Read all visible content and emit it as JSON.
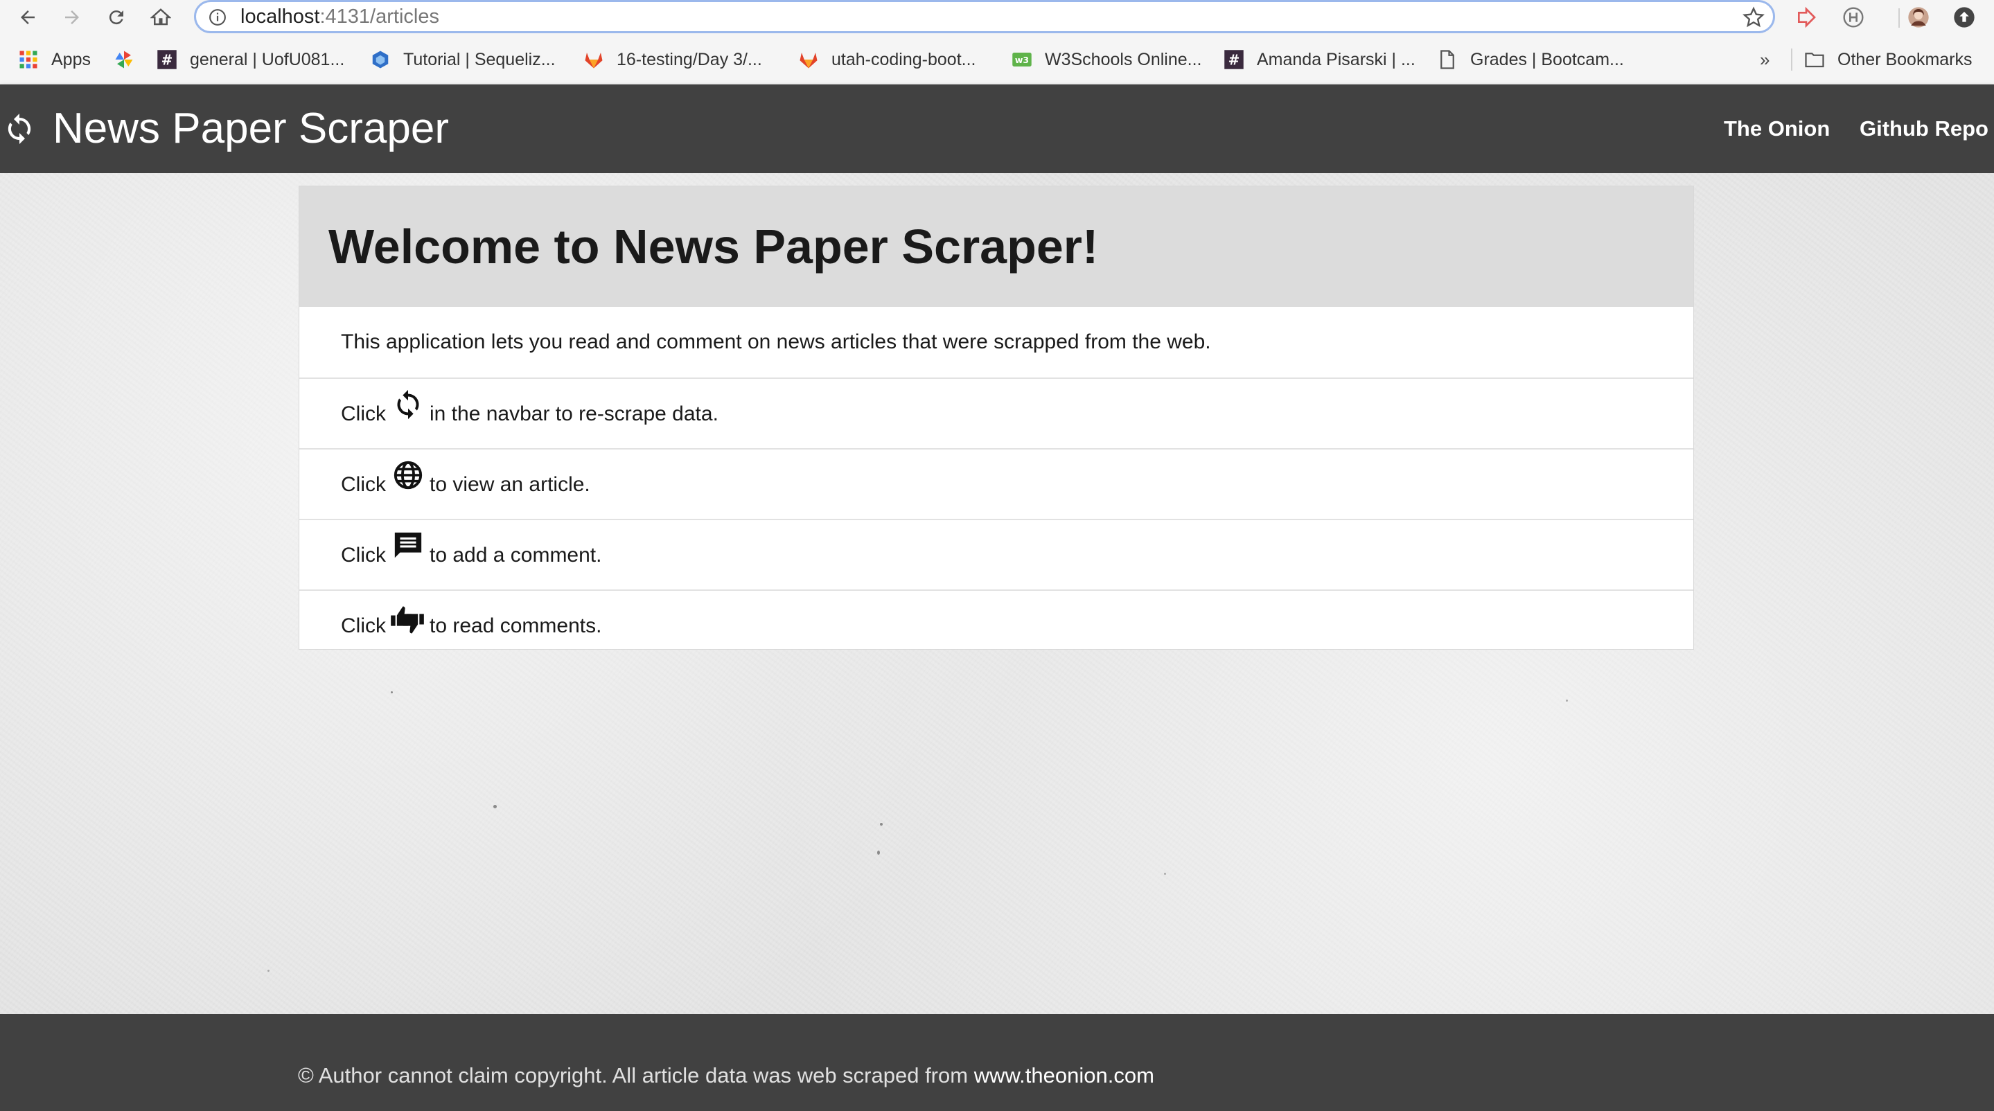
{
  "browser": {
    "url_host": "localhost",
    "url_path": ":4131/articles",
    "bookmarks": [
      {
        "label": "Apps",
        "icon": "apps-grid-icon"
      },
      {
        "label": "",
        "icon": "pinwheel-icon"
      },
      {
        "label": "general | UofU081...",
        "icon": "slack-hash-icon"
      },
      {
        "label": "Tutorial | Sequeliz...",
        "icon": "sequelize-cube-icon"
      },
      {
        "label": "16-testing/Day 3/...",
        "icon": "gitlab-icon"
      },
      {
        "label": "utah-coding-boot...",
        "icon": "gitlab-icon"
      },
      {
        "label": "W3Schools Online...",
        "icon": "w3schools-icon"
      },
      {
        "label": "Amanda Pisarski | ...",
        "icon": "slack-hash-icon"
      },
      {
        "label": "Grades | Bootcam...",
        "icon": "document-icon"
      }
    ],
    "more_label": "»",
    "other_bookmarks": "Other Bookmarks"
  },
  "navbar": {
    "brand": "News Paper Scraper",
    "links": [
      "The Onion",
      "Github Repo"
    ]
  },
  "card": {
    "title": "Welcome to News Paper Scraper!",
    "intro": "This application lets you read and comment on news articles that were scrapped from the web.",
    "rows": [
      {
        "prefix": "Click",
        "icon": "refresh-icon",
        "suffix": "in the navbar to re-scrape data."
      },
      {
        "prefix": "Click",
        "icon": "globe-icon",
        "suffix": "to view an article."
      },
      {
        "prefix": "Click",
        "icon": "comment-icon",
        "suffix": "to add a comment."
      },
      {
        "prefix": "Click",
        "icon": "thumbs-icon",
        "suffix": "to read comments."
      }
    ]
  },
  "footer": {
    "text": "© Author cannot claim copyright. All article data was web scraped from",
    "site": "www.theonion.com"
  }
}
